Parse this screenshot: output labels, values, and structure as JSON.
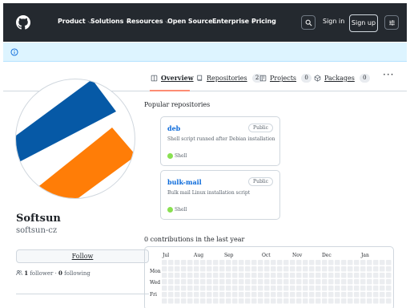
{
  "header": {
    "nav": [
      "Product",
      "Solutions",
      "Resources",
      "Open Source",
      "Enterprise",
      "Pricing"
    ],
    "nav_dropdown_flags": [
      true,
      true,
      true,
      true,
      true,
      false
    ],
    "sign_in": "Sign in",
    "sign_up": "Sign up"
  },
  "tabs": [
    {
      "label": "Overview",
      "count": null,
      "icon": "book-icon",
      "active": true
    },
    {
      "label": "Repositories",
      "count": "2",
      "icon": "repo-icon"
    },
    {
      "label": "Projects",
      "count": "0",
      "icon": "project-icon"
    },
    {
      "label": "Packages",
      "count": "0",
      "icon": "package-icon"
    }
  ],
  "profile": {
    "name": "Softsun",
    "login": "softsun-cz",
    "follow_label": "Follow",
    "followers_count": "1",
    "followers_label": "follower",
    "separator": "·",
    "following_count": "0",
    "following_label": "following"
  },
  "popular": {
    "title": "Popular repositories",
    "repos": [
      {
        "name": "deb",
        "visibility": "Public",
        "description": "Shell script runned after Debian installation",
        "language": "Shell",
        "language_color": "#89e051"
      },
      {
        "name": "bulk-mail",
        "visibility": "Public",
        "description": "Bulk mail Linux installation script",
        "language": "Shell",
        "language_color": "#89e051"
      }
    ]
  },
  "contributions": {
    "title": "0 contributions in the last year",
    "months": [
      "Jul",
      "Aug",
      "Sep",
      "Oct",
      "Nov",
      "Dec",
      "Jan"
    ],
    "days": [
      "Mon",
      "Wed",
      "Fri"
    ]
  },
  "colors": {
    "header_bg": "#24292f",
    "banner_bg": "#ddf4ff",
    "link": "#0969da",
    "tab_underline": "#fd8c73",
    "contrib_empty": "#ebedf0"
  }
}
